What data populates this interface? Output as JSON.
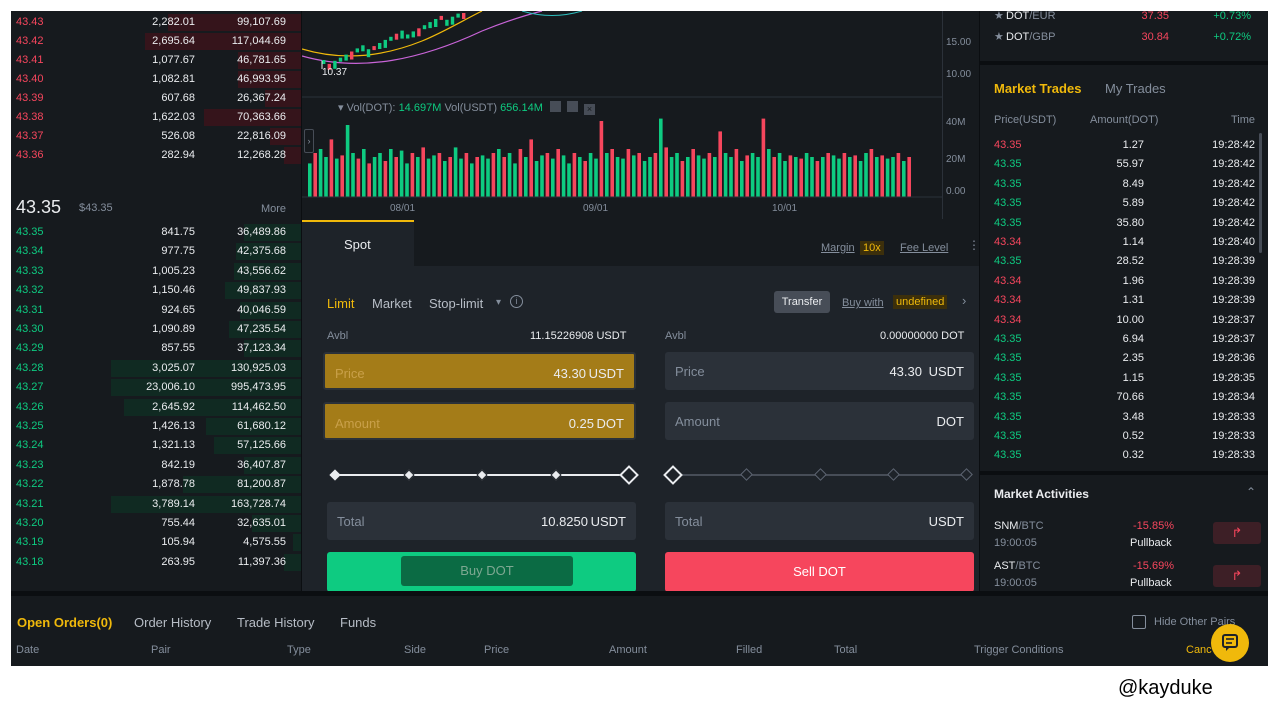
{
  "orderbook": {
    "asks": [
      {
        "price": "43.43",
        "amount": "2,282.01",
        "total": "99,107.69",
        "depth": 0.78
      },
      {
        "price": "43.42",
        "amount": "2,695.64",
        "total": "117,044.69",
        "depth": 0.92
      },
      {
        "price": "43.41",
        "amount": "1,077.67",
        "total": "46,781.65",
        "depth": 0.37
      },
      {
        "price": "43.40",
        "amount": "1,082.81",
        "total": "46,993.95",
        "depth": 0.37
      },
      {
        "price": "43.39",
        "amount": "607.68",
        "total": "26,367.24",
        "depth": 0.21
      },
      {
        "price": "43.38",
        "amount": "1,622.03",
        "total": "70,363.66",
        "depth": 0.57
      },
      {
        "price": "43.37",
        "amount": "526.08",
        "total": "22,816.09",
        "depth": 0.18
      },
      {
        "price": "43.36",
        "amount": "282.94",
        "total": "12,268.28",
        "depth": 0.1
      }
    ],
    "last_price": "43.35",
    "last_price_usd": "$43.35",
    "more_label": "More",
    "bids": [
      {
        "price": "43.35",
        "amount": "841.75",
        "total": "36,489.86",
        "depth": 0.3
      },
      {
        "price": "43.34",
        "amount": "977.75",
        "total": "42,375.68",
        "depth": 0.34
      },
      {
        "price": "43.33",
        "amount": "1,005.23",
        "total": "43,556.62",
        "depth": 0.35
      },
      {
        "price": "43.32",
        "amount": "1,150.46",
        "total": "49,837.93",
        "depth": 0.4
      },
      {
        "price": "43.31",
        "amount": "924.65",
        "total": "40,046.59",
        "depth": 0.32
      },
      {
        "price": "43.30",
        "amount": "1,090.89",
        "total": "47,235.54",
        "depth": 0.38
      },
      {
        "price": "43.29",
        "amount": "857.55",
        "total": "37,123.34",
        "depth": 0.3
      },
      {
        "price": "43.28",
        "amount": "3,025.07",
        "total": "130,925.03",
        "depth": 1.0
      },
      {
        "price": "43.27",
        "amount": "23,006.10",
        "total": "995,473.95",
        "depth": 1.0
      },
      {
        "price": "43.26",
        "amount": "2,645.92",
        "total": "114,462.50",
        "depth": 0.93
      },
      {
        "price": "43.25",
        "amount": "1,426.13",
        "total": "61,680.12",
        "depth": 0.5
      },
      {
        "price": "43.24",
        "amount": "1,321.13",
        "total": "57,125.66",
        "depth": 0.46
      },
      {
        "price": "43.23",
        "amount": "842.19",
        "total": "36,407.87",
        "depth": 0.3
      },
      {
        "price": "43.22",
        "amount": "1,878.78",
        "total": "81,200.87",
        "depth": 0.62
      },
      {
        "price": "43.21",
        "amount": "3,789.14",
        "total": "163,728.74",
        "depth": 1.0
      },
      {
        "price": "43.20",
        "amount": "755.44",
        "total": "32,635.01",
        "depth": 0.26
      },
      {
        "price": "43.19",
        "amount": "105.94",
        "total": "4,575.55",
        "depth": 0.04
      },
      {
        "price": "43.18",
        "amount": "263.95",
        "total": "11,397.36",
        "depth": 0.09
      }
    ]
  },
  "chart": {
    "price_labels": [
      "15.00",
      "10.00"
    ],
    "low_marker": "10.37",
    "volume_label": "Vol(DOT):",
    "volume_dot": "14.697M",
    "volume_usdt_label": "Vol(USDT)",
    "volume_usdt": "656.14M",
    "vol_axis": [
      "40M",
      "20M",
      "0.00"
    ],
    "dates": [
      "08/01",
      "09/01",
      "10/01"
    ],
    "volumes": [
      0.42,
      0.55,
      0.6,
      0.5,
      0.72,
      0.48,
      0.52,
      0.9,
      0.55,
      0.48,
      0.6,
      0.42,
      0.5,
      0.55,
      0.45,
      0.6,
      0.5,
      0.58,
      0.42,
      0.55,
      0.5,
      0.62,
      0.48,
      0.52,
      0.55,
      0.45,
      0.5,
      0.62,
      0.48,
      0.55,
      0.42,
      0.5,
      0.52,
      0.48,
      0.55,
      0.6,
      0.5,
      0.55,
      0.42,
      0.6,
      0.5,
      0.72,
      0.45,
      0.52,
      0.55,
      0.48,
      0.6,
      0.52,
      0.42,
      0.55,
      0.5,
      0.45,
      0.55,
      0.48,
      0.95,
      0.55,
      0.6,
      0.5,
      0.48,
      0.6,
      0.52,
      0.55,
      0.45,
      0.5,
      0.55,
      0.98,
      0.62,
      0.5,
      0.55,
      0.45,
      0.5,
      0.6,
      0.52,
      0.48,
      0.55,
      0.5,
      0.82,
      0.55,
      0.5,
      0.6,
      0.45,
      0.52,
      0.55,
      0.5,
      0.98,
      0.6,
      0.5,
      0.55,
      0.45,
      0.52,
      0.5,
      0.48,
      0.55,
      0.5,
      0.45,
      0.5,
      0.55,
      0.52,
      0.48,
      0.55,
      0.5,
      0.52,
      0.45,
      0.55,
      0.6,
      0.5,
      0.52,
      0.48,
      0.5,
      0.55,
      0.45,
      0.5
    ],
    "colors": [
      "#f6465d",
      "#0ecb81"
    ]
  },
  "trade": {
    "tab_spot": "Spot",
    "margin": "Margin",
    "margin_lev": "10x",
    "fee_level": "Fee Level",
    "order_types": [
      "Limit",
      "Market",
      "Stop-limit"
    ],
    "transfer": "Transfer",
    "buy_with": "Buy with",
    "buy_with_value": "undefined",
    "buy": {
      "avbl_label": "Avbl",
      "avbl": "11.15226908 USDT",
      "price_label": "Price",
      "price": "43.30",
      "price_unit": "USDT",
      "amount_label": "Amount",
      "amount": "0.25",
      "amount_unit": "DOT",
      "total_label": "Total",
      "total": "10.8250",
      "total_unit": "USDT",
      "button": "Buy DOT"
    },
    "sell": {
      "avbl_label": "Avbl",
      "avbl": "0.00000000 DOT",
      "price_label": "Price",
      "price": "43.30",
      "price_unit": "USDT",
      "amount_label": "Amount",
      "amount_unit": "DOT",
      "total_label": "Total",
      "total_unit": "USDT",
      "button": "Sell DOT"
    }
  },
  "pairs": [
    {
      "symbol": "DOT",
      "quote": "/EUR",
      "price": "37.35",
      "change": "+0.73%"
    },
    {
      "symbol": "DOT",
      "quote": "/GBP",
      "price": "30.84",
      "change": "+0.72%"
    }
  ],
  "market_trades": {
    "tab_market": "Market Trades",
    "tab_my": "My Trades",
    "col_price": "Price(USDT)",
    "col_amount": "Amount(DOT)",
    "col_time": "Time",
    "rows": [
      {
        "price": "43.35",
        "amount": "1.27",
        "time": "19:28:42",
        "side": "sell"
      },
      {
        "price": "43.35",
        "amount": "55.97",
        "time": "19:28:42",
        "side": "buy"
      },
      {
        "price": "43.35",
        "amount": "8.49",
        "time": "19:28:42",
        "side": "buy"
      },
      {
        "price": "43.35",
        "amount": "5.89",
        "time": "19:28:42",
        "side": "buy"
      },
      {
        "price": "43.35",
        "amount": "35.80",
        "time": "19:28:42",
        "side": "buy"
      },
      {
        "price": "43.34",
        "amount": "1.14",
        "time": "19:28:40",
        "side": "sell"
      },
      {
        "price": "43.35",
        "amount": "28.52",
        "time": "19:28:39",
        "side": "buy"
      },
      {
        "price": "43.34",
        "amount": "1.96",
        "time": "19:28:39",
        "side": "sell"
      },
      {
        "price": "43.34",
        "amount": "1.31",
        "time": "19:28:39",
        "side": "sell"
      },
      {
        "price": "43.34",
        "amount": "10.00",
        "time": "19:28:37",
        "side": "sell"
      },
      {
        "price": "43.35",
        "amount": "6.94",
        "time": "19:28:37",
        "side": "buy"
      },
      {
        "price": "43.35",
        "amount": "2.35",
        "time": "19:28:36",
        "side": "buy"
      },
      {
        "price": "43.35",
        "amount": "1.15",
        "time": "19:28:35",
        "side": "buy"
      },
      {
        "price": "43.35",
        "amount": "70.66",
        "time": "19:28:34",
        "side": "buy"
      },
      {
        "price": "43.35",
        "amount": "3.48",
        "time": "19:28:33",
        "side": "buy"
      },
      {
        "price": "43.35",
        "amount": "0.52",
        "time": "19:28:33",
        "side": "buy"
      },
      {
        "price": "43.35",
        "amount": "0.32",
        "time": "19:28:33",
        "side": "buy"
      }
    ]
  },
  "market_activities": {
    "title": "Market Activities",
    "items": [
      {
        "symbol": "SNM",
        "quote": "/BTC",
        "time": "19:00:05",
        "change": "-15.85%",
        "label": "Pullback"
      },
      {
        "symbol": "AST",
        "quote": "/BTC",
        "time": "19:00:05",
        "change": "-15.69%",
        "label": "Pullback"
      }
    ]
  },
  "bottom": {
    "tabs": [
      "Open Orders(0)",
      "Order History",
      "Trade History",
      "Funds"
    ],
    "hide_other_pairs": "Hide Other Pairs",
    "columns": [
      "Date",
      "Pair",
      "Type",
      "Side",
      "Price",
      "Amount",
      "Filled",
      "Total",
      "Trigger Conditions"
    ],
    "cancel": "Canc"
  },
  "watermark": "@kayduke"
}
